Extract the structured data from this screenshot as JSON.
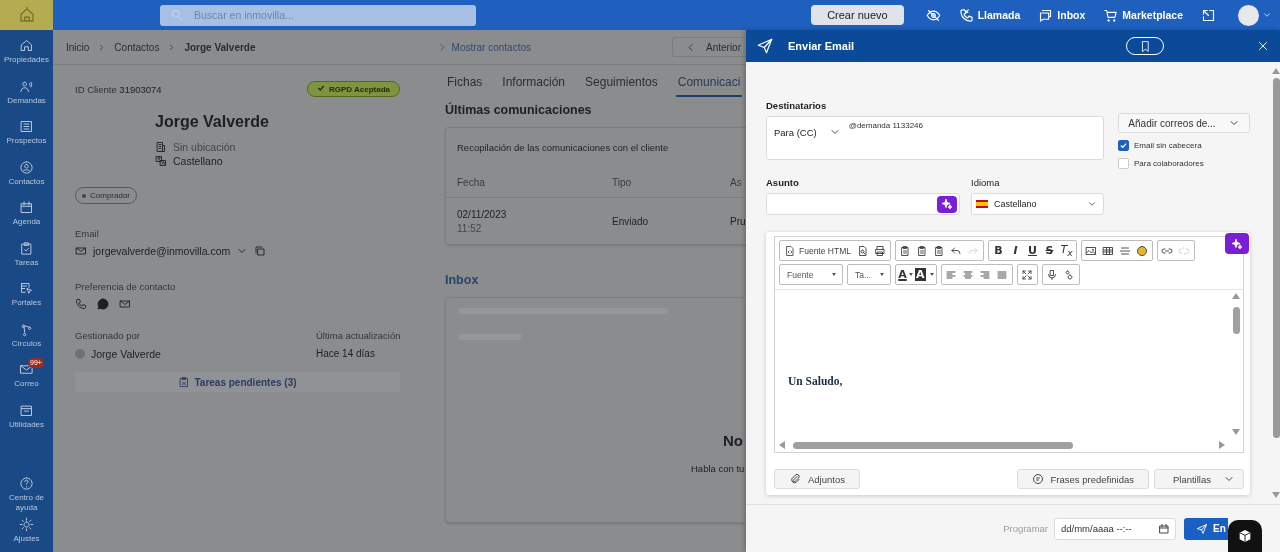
{
  "topbar": {
    "search": {
      "placeholder": "Buscar en inmovilla..."
    },
    "create_button": "Crear nuevo",
    "actions": [
      {
        "kind": "eye-off"
      },
      {
        "kind": "call",
        "label": "Llamada"
      },
      {
        "kind": "chat",
        "label": "Inbox"
      },
      {
        "kind": "cart",
        "label": "Marketplace"
      },
      {
        "kind": "external"
      }
    ]
  },
  "sidebar": {
    "items": [
      {
        "kind": "home",
        "label": "Propiedades"
      },
      {
        "kind": "people",
        "label": "Demandas"
      },
      {
        "kind": "list",
        "label": "Prospectos"
      },
      {
        "kind": "person",
        "label": "Contactos"
      },
      {
        "kind": "calendar",
        "label": "Agenda"
      },
      {
        "kind": "tasks",
        "label": "Tareas"
      },
      {
        "kind": "portal",
        "label": "Portales"
      },
      {
        "kind": "network",
        "label": "Círculos"
      },
      {
        "kind": "mail",
        "label": "Correo",
        "badge": "99+"
      },
      {
        "kind": "box",
        "label": "Utilidades"
      }
    ],
    "bottom_items": [
      {
        "kind": "help",
        "label": "Centro de ayuda"
      },
      {
        "kind": "gear",
        "label": "Ajustes"
      }
    ]
  },
  "breadcrumb": [
    "Inicio",
    "Contactos",
    "Jorge Valverde"
  ],
  "show_contacts": "Mostrar contactos",
  "previous_button": "Anterior",
  "contact": {
    "id_label": "ID Cliente",
    "id": "31903074",
    "rgpd": "RGPD Aceptada",
    "name": "Jorge Valverde",
    "location": "Sin ubicación",
    "language": "Castellano",
    "tag": "Comprador",
    "email_label": "Email",
    "email": "jorgevalverde@inmovilla.com",
    "preference_label": "Preferencia de contacto",
    "preferences": [
      {
        "kind": "phone"
      },
      {
        "kind": "whatsapp"
      },
      {
        "kind": "mail"
      }
    ],
    "managed_label": "Gestionado por",
    "managed_by": "Jorge Valverde",
    "updated_label": "Última actualización",
    "updated": "Hace 14 días",
    "tasks_button": "Tareas pendientes (3)"
  },
  "tabs": [
    {
      "label": "Fichas",
      "selected": false
    },
    {
      "label": "Información",
      "selected": false
    },
    {
      "label": "Seguimientos",
      "selected": false
    },
    {
      "label": "Comunicaci",
      "selected": true
    }
  ],
  "communications": {
    "title": "Últimas comunicaciones",
    "card_title": "Recopilación de las comunicaciones con el cliente",
    "columns": [
      "Fecha",
      "Tipo",
      "As"
    ],
    "rows": [
      {
        "date": "02/11/2023",
        "time": "11:52",
        "type": "Enviado",
        "subject": "Pru"
      }
    ]
  },
  "inbox": {
    "title": "Inbox",
    "empty_title": "No",
    "empty_text": "Habla con tu"
  },
  "email": {
    "title": "Enviar Email",
    "recipients_label": "Destinatarios",
    "recipient_mode": "Para (CC)",
    "recipients": "@demanda 1133246",
    "add_button": "Añadir correos de...",
    "options": [
      {
        "label": "Email sin cabecera",
        "checked": true
      },
      {
        "label": "Para colaboradores",
        "checked": false
      }
    ],
    "subject_label": "Asunto",
    "language_label": "Idioma",
    "language": "Castellano",
    "toolbar": [
      [
        [
          {
            "kind": "source",
            "label": "Fuente HTML",
            "disabled": false
          },
          {
            "kind": "preview",
            "disabled": false
          },
          {
            "kind": "print",
            "disabled": false
          }
        ],
        [
          {
            "kind": "paste",
            "disabled": false
          },
          {
            "kind": "paste",
            "disabled": false
          },
          {
            "kind": "paste",
            "disabled": false
          },
          {
            "kind": "undo",
            "disabled": false
          },
          {
            "kind": "redo",
            "disabled": true
          }
        ],
        [
          {
            "kind": "bold",
            "label": "B",
            "disabled": false
          },
          {
            "kind": "italic",
            "label": "I",
            "disabled": false
          },
          {
            "kind": "underline",
            "label": "U",
            "disabled": false
          },
          {
            "kind": "strike",
            "label": "S",
            "disabled": false
          },
          {
            "kind": "clear",
            "label": "T$_{x}$",
            "disabled": false
          }
        ],
        [
          {
            "kind": "image",
            "disabled": false
          },
          {
            "kind": "table",
            "disabled": false
          },
          {
            "kind": "rule",
            "disabled": false
          },
          {
            "kind": "emoji",
            "disabled": false
          }
        ],
        [
          {
            "kind": "link",
            "disabled": false
          },
          {
            "kind": "unlink",
            "disabled": true
          }
        ]
      ],
      [
        [
          {
            "kind": "select",
            "label": "Fuente",
            "disabled": false
          }
        ],
        [
          {
            "kind": "select",
            "label": "Ta...",
            "disabled": false
          }
        ],
        [
          {
            "kind": "color",
            "label": "A",
            "disabled": false
          },
          {
            "kind": "bgcolor",
            "label": "A",
            "disabled": false
          }
        ],
        [
          {
            "kind": "align-left",
            "disabled": false
          },
          {
            "kind": "align-center",
            "disabled": false
          },
          {
            "kind": "align-right",
            "disabled": false
          },
          {
            "kind": "justify",
            "disabled": false
          }
        ],
        [
          {
            "kind": "maximize",
            "disabled": false
          }
        ],
        [
          {
            "kind": "mic",
            "disabled": false
          },
          {
            "kind": "special",
            "disabled": false
          }
        ]
      ]
    ],
    "body": "Un Saludo,",
    "attach_button": "Adjuntos",
    "phrases_button": "Frases predefinidas",
    "templates_button": "Plantillas",
    "schedule_label": "Programar",
    "schedule": {
      "placeholder": "dd/mm/aaaa --:--"
    },
    "send_button": "En"
  }
}
